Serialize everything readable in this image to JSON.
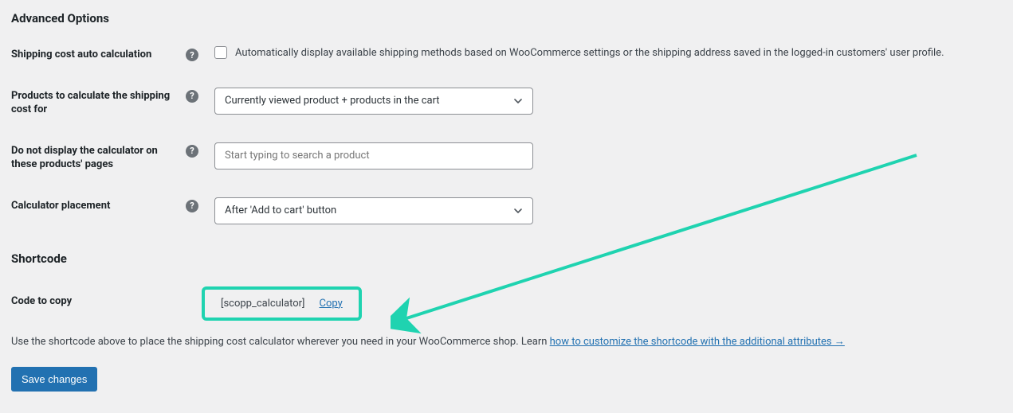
{
  "headings": {
    "advanced": "Advanced Options",
    "shortcode": "Shortcode"
  },
  "labels": {
    "auto_calc": "Shipping cost auto calculation",
    "products_for": "Products to calculate the shipping cost for",
    "exclude_products": "Do not display the calculator on these products' pages",
    "placement": "Calculator placement",
    "code_to_copy": "Code to copy"
  },
  "fields": {
    "auto_calc_desc": "Automatically display available shipping methods based on WooCommerce settings or the shipping address saved in the logged-in customers' user profile.",
    "products_for_value": "Currently viewed product + products in the cart",
    "exclude_placeholder": "Start typing to search a product",
    "placement_value": "After 'Add to cart' button"
  },
  "shortcode": {
    "code": "[scopp_calculator]",
    "copy": "Copy",
    "desc_prefix": "Use the shortcode above to place the shipping cost calculator wherever you need in your WooCommerce shop. Learn ",
    "desc_link": "how to customize the shortcode with the additional attributes →"
  },
  "buttons": {
    "save": "Save changes"
  }
}
